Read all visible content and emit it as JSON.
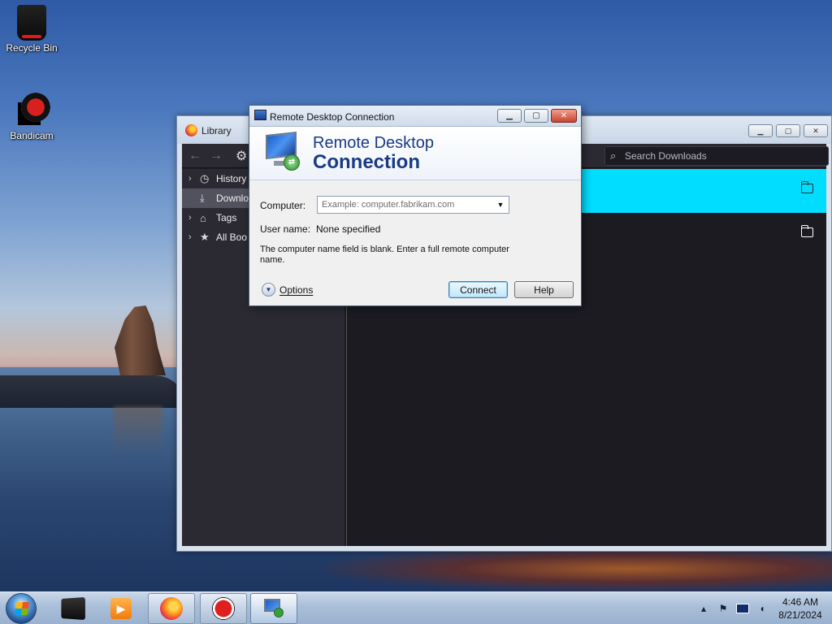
{
  "desktop": {
    "icons": [
      {
        "label": "Recycle Bin",
        "icon": "recycle-bin-icon"
      },
      {
        "label": "Bandicam",
        "icon": "bandicam-icon"
      }
    ]
  },
  "library": {
    "title": "Library",
    "search_placeholder": "Search Downloads",
    "sidebar": [
      {
        "label": "History",
        "icon": "clock-icon",
        "selected": false
      },
      {
        "label": "Downlo",
        "icon": "download-icon",
        "selected": true
      },
      {
        "label": "Tags",
        "icon": "tag-icon",
        "selected": false
      },
      {
        "label": "All Boo",
        "icon": "star-icon",
        "selected": false
      }
    ],
    "colors": {
      "selected_row": "#00ddff",
      "background": "#1c1b22"
    }
  },
  "rdc": {
    "title": "Remote Desktop Connection",
    "banner_line1": "Remote Desktop",
    "banner_line2": "Connection",
    "computer_label": "Computer:",
    "computer_placeholder": "Example: computer.fabrikam.com",
    "username_label": "User name:",
    "username_value": "None specified",
    "message": "The computer name field is blank. Enter a full remote computer name.",
    "options_label": "Options",
    "connect_label": "Connect",
    "help_label": "Help"
  },
  "taskbar": {
    "clock_time": "4:46 AM",
    "clock_date": "8/21/2024",
    "buttons": [
      "start-orb",
      "system-box-icon",
      "media-player-icon",
      "firefox-icon",
      "bandicam-record-icon",
      "remote-desktop-icon"
    ]
  }
}
